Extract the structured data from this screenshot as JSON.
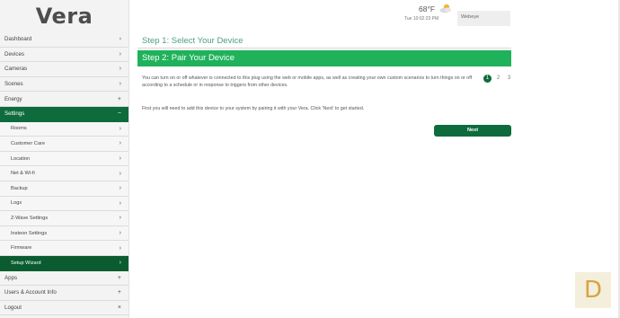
{
  "app": {
    "logo_text": "Vera"
  },
  "header": {
    "temperature": "68°F",
    "datetime": "Tue 10:02:23 PM",
    "user": "Webeye",
    "weather_icon": "partly-cloudy-icon"
  },
  "sidebar": {
    "items": [
      {
        "label": "Dashboard",
        "indicator": "›"
      },
      {
        "label": "Devices",
        "indicator": "›"
      },
      {
        "label": "Cameras",
        "indicator": "›"
      },
      {
        "label": "Scenes",
        "indicator": "›"
      },
      {
        "label": "Energy",
        "indicator": "+"
      },
      {
        "label": "Settings",
        "indicator": "−"
      },
      {
        "label": "Rooms",
        "indicator": "›"
      },
      {
        "label": "Customer Care",
        "indicator": "›"
      },
      {
        "label": "Location",
        "indicator": "›"
      },
      {
        "label": "Net & Wi-fi",
        "indicator": "›"
      },
      {
        "label": "Backup",
        "indicator": "›"
      },
      {
        "label": "Logs",
        "indicator": "›"
      },
      {
        "label": "Z-Wave Settings",
        "indicator": "›"
      },
      {
        "label": "Insteon Settings",
        "indicator": "›"
      },
      {
        "label": "Firmware",
        "indicator": "›"
      },
      {
        "label": "Setup Wizard",
        "indicator": "›"
      },
      {
        "label": "Apps",
        "indicator": "+"
      },
      {
        "label": "Users & Account Info",
        "indicator": "+"
      },
      {
        "label": "Logout",
        "indicator": "×"
      }
    ]
  },
  "main": {
    "step1_title": "Step 1: Select Your Device",
    "step2_title": "Step 2: Pair Your Device",
    "description": "You can turn on or off whatever is connected to this plug using the web or mobile apps, as well as creating your own custom scenarios to turn things on or off according to a schedule or in response to triggers from other devices.",
    "first_instruction": "First you will need to add this device to your system by pairing it with your Vera. Click 'Next' to get started.",
    "pages": [
      "1",
      "2",
      "3"
    ],
    "current_page": "1",
    "next_label": "Next"
  },
  "corner_badge": {
    "letter": "D"
  },
  "colors": {
    "brand_dark_green": "#0e6b3c",
    "step_green": "#1fb25a",
    "step1_teal": "#4f9d86"
  }
}
